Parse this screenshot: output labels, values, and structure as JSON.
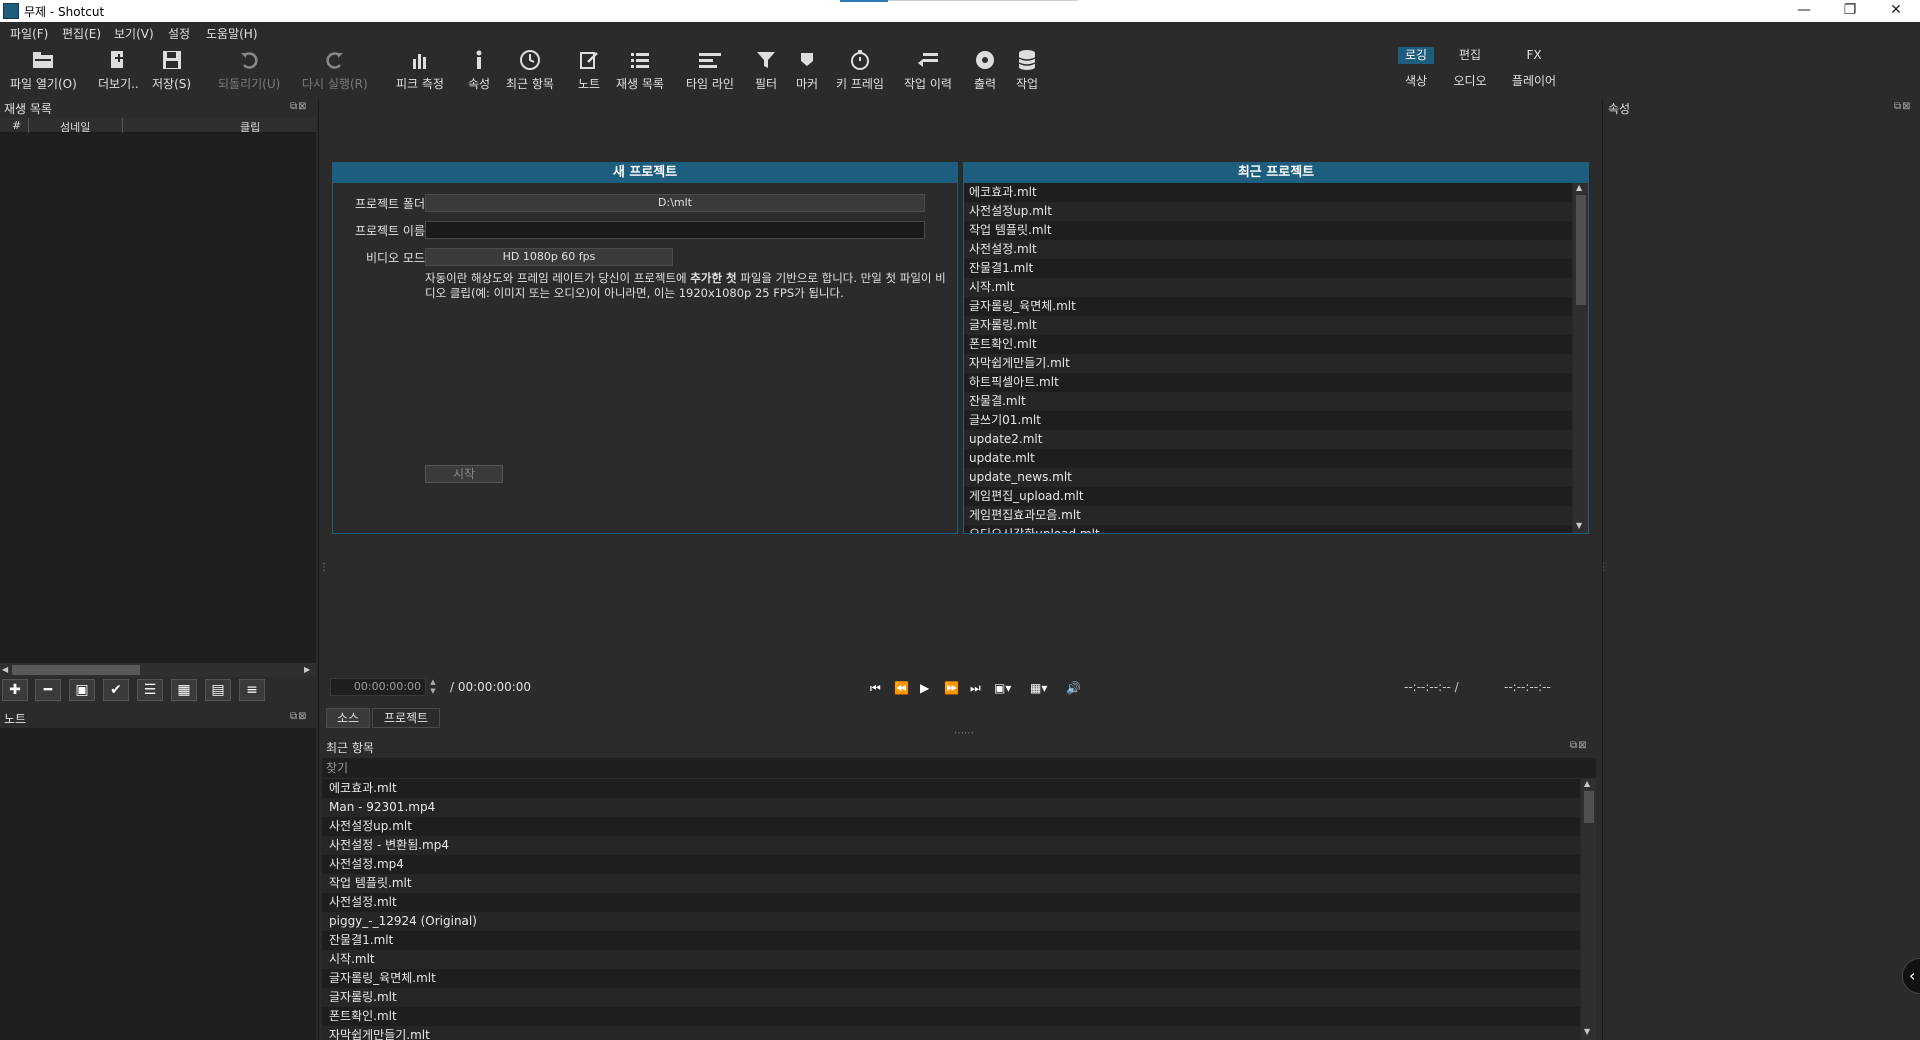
{
  "window": {
    "title": "무제 - Shotcut",
    "minimize_label": "—",
    "restore_label": "❐",
    "close_label": "✕"
  },
  "menu": [
    "파일(F)",
    "편집(E)",
    "보기(V)",
    "설정",
    "도움말(H)"
  ],
  "toolbar": {
    "open": "파일 열기(O)",
    "more": "더보기..",
    "save": "저장(S)",
    "undo": "되돌리기(U)",
    "redo": "다시 실행(R)",
    "peak_meter": "피크 측정",
    "properties": "속성",
    "recent": "최근 항목",
    "notes": "노트",
    "playlist": "재생 목록",
    "timeline": "타임 라인",
    "filters": "필터",
    "markers": "마커",
    "keyframes": "키 프레임",
    "history": "작업 이력",
    "export": "출력",
    "jobs": "작업"
  },
  "layouts": {
    "logging": "로깅",
    "editing": "편집",
    "fx": "FX",
    "color": "색상",
    "audio": "오디오",
    "player": "플레이어"
  },
  "playlist_panel": {
    "title": "재생 목록",
    "col_num": "#",
    "col_thumb": "섬네일",
    "col_clip": "클립"
  },
  "notes_panel": {
    "title": "노트"
  },
  "properties_panel": {
    "title": "속성"
  },
  "new_project": {
    "heading": "새 프로젝트",
    "folder_label": "프로젝트 폴더",
    "folder_value": "D:\\mlt",
    "name_label": "프로젝트 이름",
    "name_value": "",
    "video_mode_label": "비디오 모드",
    "video_mode_value": "HD 1080p 60 fps",
    "desc_pre": "자동이란 해상도와 프레임 레이트가 당신이 프로젝트에 ",
    "desc_bold": "추가한 첫",
    "desc_post": " 파일을 기반으로 합니다. 만일 첫 파일이 비디오 클립(예: 이미지 또는 오디오)이 아니라면, 이는 1920x1080p 25 FPS가 됩니다.",
    "start_button": "시작"
  },
  "recent_projects": {
    "heading": "최근 프로젝트",
    "items": [
      "에코효과.mlt",
      "사전설정up.mlt",
      "작업 템플릿.mlt",
      "사전설정.mlt",
      "잔물결1.mlt",
      "시작.mlt",
      "글자롤링_육면체.mlt",
      "글자롤링.mlt",
      "폰트확인.mlt",
      "자막쉽게만들기.mlt",
      "하트픽셀아트.mlt",
      "잔물결.mlt",
      "글쓰기01.mlt",
      "update2.mlt",
      "update.mlt",
      "update_news.mlt",
      "게임편집_upload.mlt",
      "게임편집효과모음.mlt",
      "오디오시각화upload.mlt"
    ]
  },
  "transport": {
    "position": "00:00:00:00",
    "duration": "/ 00:00:00:00",
    "in_point": "--:--:--:-- /",
    "out_point": "--:--:--:--"
  },
  "bottom_tabs": {
    "source": "소스",
    "project": "프로젝트"
  },
  "recent_panel": {
    "title": "최근 항목",
    "search_placeholder": "찾기",
    "items": [
      "에코효과.mlt",
      "Man - 92301.mp4",
      "사전설정up.mlt",
      "사전설정 - 변환됨.mp4",
      "사전설정.mp4",
      "작업 템플릿.mlt",
      "사전설정.mlt",
      "piggy_-_12924 (Original)",
      "잔물결1.mlt",
      "시작.mlt",
      "글자롤링_육면체.mlt",
      "글자롤링.mlt",
      "폰트확인.mlt",
      "자막쉽게만들기.mlt"
    ]
  },
  "colors": {
    "accent": "#1d5d7e",
    "bg": "#2b2b2b",
    "list_dark": "#1e1e1e"
  }
}
